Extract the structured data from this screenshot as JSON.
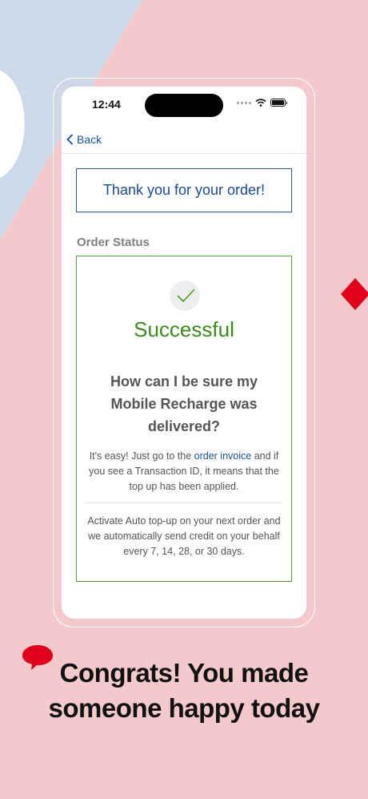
{
  "status_bar": {
    "time": "12:44"
  },
  "nav": {
    "back_label": "Back"
  },
  "confirmation": {
    "title": "Thank you for your order!"
  },
  "order_status": {
    "label": "Order Status",
    "result": "Successful",
    "question": "How can I be sure my Mobile Recharge was delivered?",
    "info_before_link": "It's easy! Just go to the ",
    "info_link": "order invoice",
    "info_after_link": " and if you see a Transaction ID, it means that the top up has been applied.",
    "auto_topup_text": "Activate Auto top-up on your next order and we automatically send credit on your behalf every 7, 14, 28, or 30 days."
  },
  "headline": {
    "line1": "Congrats! You made",
    "line2": "someone happy today"
  },
  "colors": {
    "background": "#f4c9cb",
    "accent_blue": "#1b4f9c",
    "success_green": "#3b8a1e",
    "brand_red": "#e0001b"
  }
}
